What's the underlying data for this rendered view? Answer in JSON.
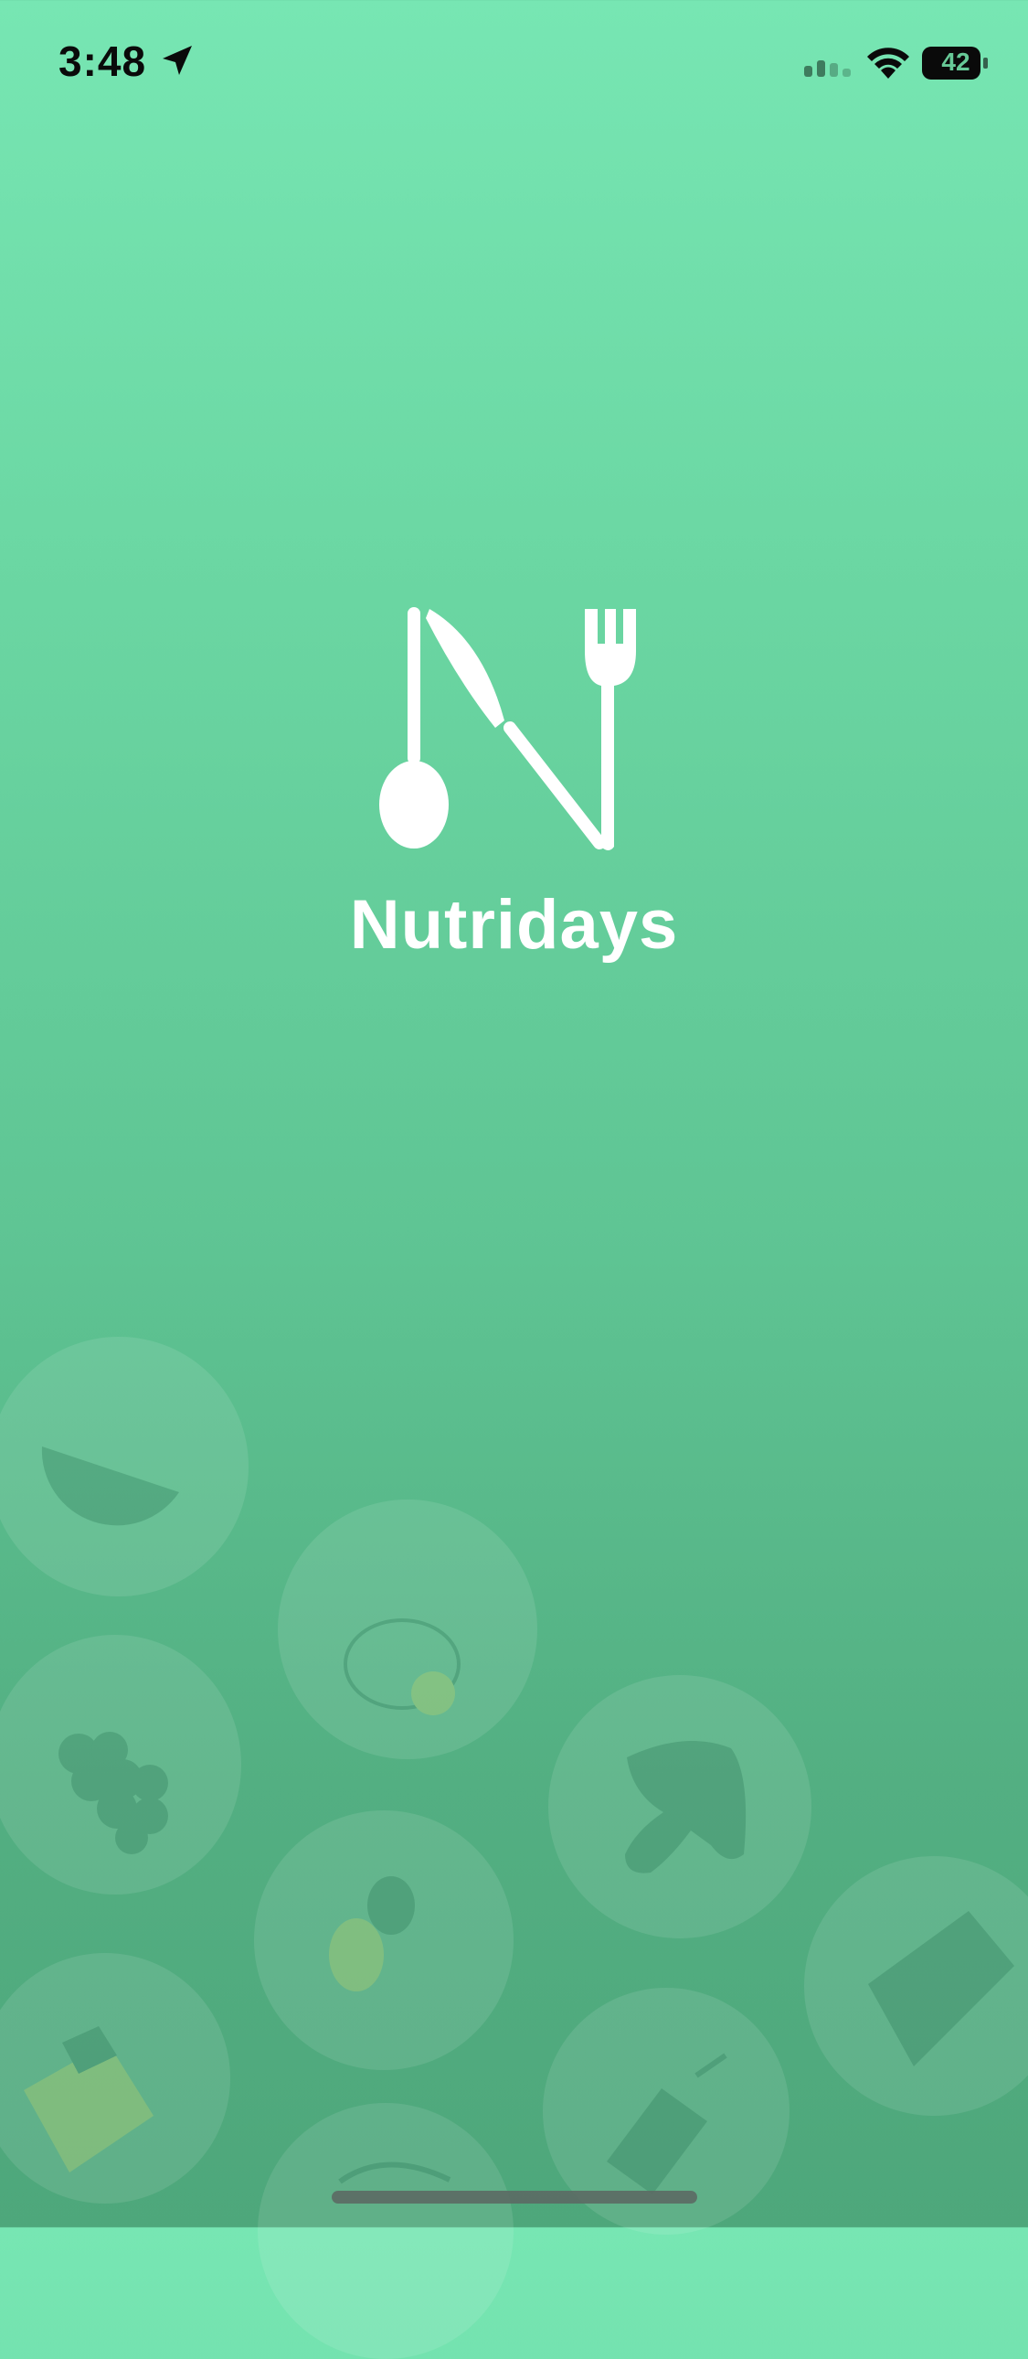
{
  "status_bar": {
    "time": "3:48",
    "battery": "42",
    "icons": [
      "location-arrow-icon",
      "cellular-signal-icon",
      "wifi-icon",
      "battery-icon"
    ]
  },
  "splash": {
    "app_name": "Nutridays",
    "logo_icon": "utensils-n-logo-icon"
  },
  "background": {
    "decorations": [
      "watermelon-icon",
      "fried-egg-icon",
      "grapes-icon",
      "mushroom-icon",
      "avocado-icon",
      "bread-icon",
      "vegetable-box-icon",
      "drink-icon",
      "noodles-icon"
    ]
  },
  "colors": {
    "gradient_top": "#77e6b3",
    "gradient_bottom": "#4ea77b",
    "text": "#ffffff"
  }
}
